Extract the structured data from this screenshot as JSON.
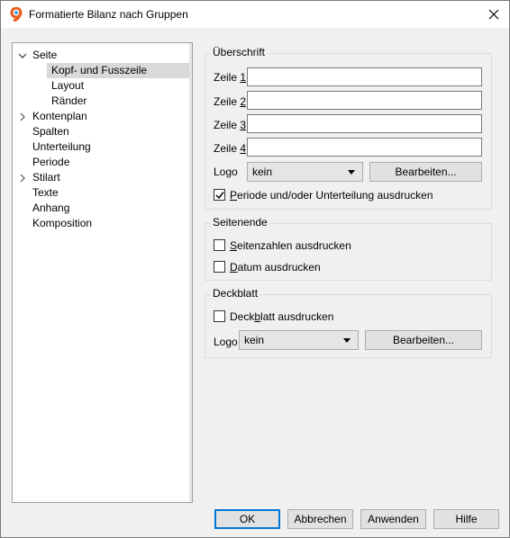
{
  "window": {
    "title": "Formatierte Bilanz nach Gruppen"
  },
  "tree": {
    "items": [
      {
        "label": "Seite",
        "expanded": true
      },
      {
        "label": "Kopf- und Fusszeile",
        "selected": true
      },
      {
        "label": "Layout"
      },
      {
        "label": "Ränder"
      },
      {
        "label": "Kontenplan",
        "collapsed": true
      },
      {
        "label": "Spalten"
      },
      {
        "label": "Unterteilung"
      },
      {
        "label": "Periode"
      },
      {
        "label": "Stilart",
        "collapsed": true
      },
      {
        "label": "Texte"
      },
      {
        "label": "Anhang"
      },
      {
        "label": "Komposition"
      }
    ]
  },
  "header_group": {
    "title": "Überschrift",
    "rows": [
      {
        "prefix": "Zeile ",
        "mnemonic": "1",
        "value": ""
      },
      {
        "prefix": "Zeile ",
        "mnemonic": "2",
        "value": ""
      },
      {
        "prefix": "Zeile ",
        "mnemonic": "3",
        "value": ""
      },
      {
        "prefix": "Zeile ",
        "mnemonic": "4",
        "value": ""
      }
    ],
    "logo_label": "Logo",
    "logo_value": "kein",
    "edit_label": "Bearbeiten...",
    "checkbox": {
      "mnemonic": "P",
      "rest": "eriode und/oder Unterteilung ausdrucken",
      "checked": true
    }
  },
  "footer_group": {
    "title": "Seitenende",
    "page_numbers": {
      "mnemonic": "S",
      "rest": "eitenzahlen ausdrucken",
      "checked": false
    },
    "date": {
      "mnemonic": "D",
      "rest": "atum ausdrucken",
      "checked": false
    }
  },
  "cover_group": {
    "title": "Deckblatt",
    "checkbox": {
      "before": "Deck",
      "mnemonic": "b",
      "rest": "latt ausdrucken",
      "checked": false
    },
    "logo_label": "Logo",
    "logo_value": "kein",
    "edit_label": "Bearbeiten..."
  },
  "buttons": {
    "ok": "OK",
    "cancel": "Abbrechen",
    "apply": "Anwenden",
    "help": "Hilfe"
  },
  "colors": {
    "accent": "#0078d7",
    "app_icon": "#e85c1a"
  }
}
